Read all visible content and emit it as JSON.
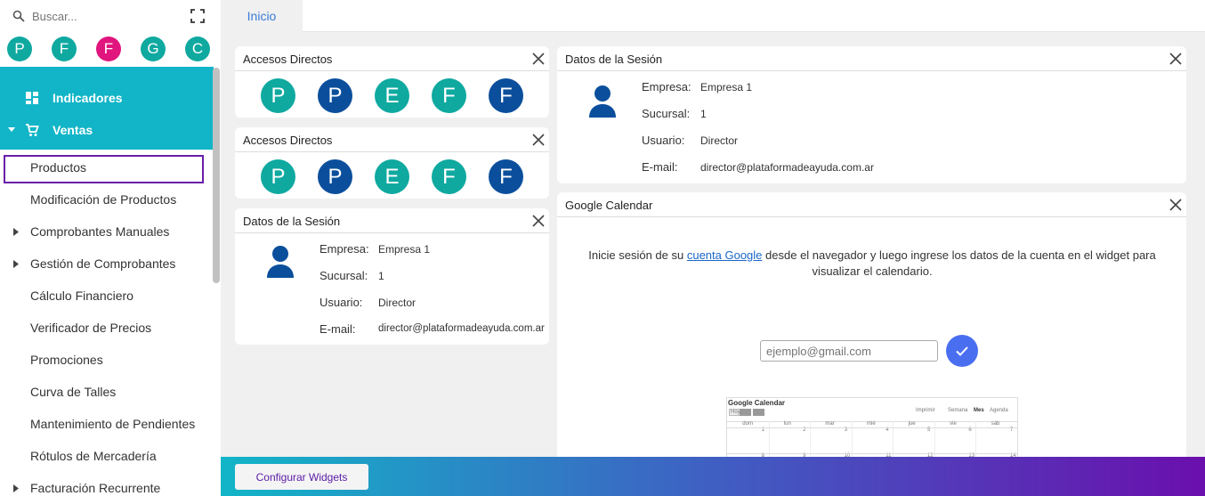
{
  "search": {
    "placeholder": "Buscar..."
  },
  "favorites": [
    {
      "letter": "P",
      "color": "#0fa9a0"
    },
    {
      "letter": "F",
      "color": "#0fa9a0"
    },
    {
      "letter": "F",
      "color": "#e0157d"
    },
    {
      "letter": "G",
      "color": "#0fa9a0"
    },
    {
      "letter": "C",
      "color": "#0fa9a0"
    }
  ],
  "menu": {
    "indicadores": "Indicadores",
    "ventas": "Ventas",
    "items": [
      {
        "label": "Productos",
        "selected": true,
        "expandable": false
      },
      {
        "label": "Modificación de Productos",
        "expandable": false
      },
      {
        "label": "Comprobantes Manuales",
        "expandable": true
      },
      {
        "label": "Gestión de Comprobantes",
        "expandable": true
      },
      {
        "label": "Cálculo Financiero",
        "expandable": false
      },
      {
        "label": "Verificador de Precios",
        "expandable": false
      },
      {
        "label": "Promociones",
        "expandable": false
      },
      {
        "label": "Curva de Talles",
        "expandable": false
      },
      {
        "label": "Mantenimiento de Pendientes",
        "expandable": false
      },
      {
        "label": "Rótulos de Mercadería",
        "expandable": false
      },
      {
        "label": "Facturación Recurrente",
        "expandable": true
      }
    ]
  },
  "tabs": [
    {
      "label": "Inicio",
      "active": true
    }
  ],
  "shortcuts": {
    "title": "Accesos Directos",
    "items": [
      {
        "letter": "P",
        "color": "#0fa9a0"
      },
      {
        "letter": "P",
        "color": "#0b4f9c"
      },
      {
        "letter": "E",
        "color": "#0fa9a0"
      },
      {
        "letter": "F",
        "color": "#0fa9a0"
      },
      {
        "letter": "F",
        "color": "#0b4f9c"
      }
    ]
  },
  "session": {
    "title": "Datos de la Sesión",
    "labels": {
      "empresa": "Empresa:",
      "sucursal": "Sucursal:",
      "usuario": "Usuario:",
      "email": "E-mail:"
    },
    "values": {
      "empresa": "Empresa 1",
      "sucursal": "1",
      "usuario": "Director",
      "email": "director@plataformadeayuda.com.ar"
    }
  },
  "calendar": {
    "title": "Google Calendar",
    "text_before": "Inicie sesión de su ",
    "link": "cuenta Google",
    "text_after": " desde el navegador y luego ingrese los datos de la cuenta en el widget para visualizar el calendario.",
    "email_placeholder": "ejemplo@gmail.com",
    "preview": {
      "title": "Google Calendar",
      "today": "Hoy",
      "print": "Imprimir",
      "week": "Semana",
      "month": "Mes",
      "agenda": "Agenda",
      "days": [
        "dom",
        "lun",
        "mar",
        "mié",
        "jue",
        "vie",
        "sáb"
      ],
      "row1": [
        "1",
        "2",
        "3",
        "4",
        "5",
        "6",
        "7"
      ],
      "row2": [
        "8",
        "9",
        "10",
        "11",
        "12",
        "13",
        "14"
      ]
    }
  },
  "footer": {
    "configure": "Configurar Widgets"
  }
}
